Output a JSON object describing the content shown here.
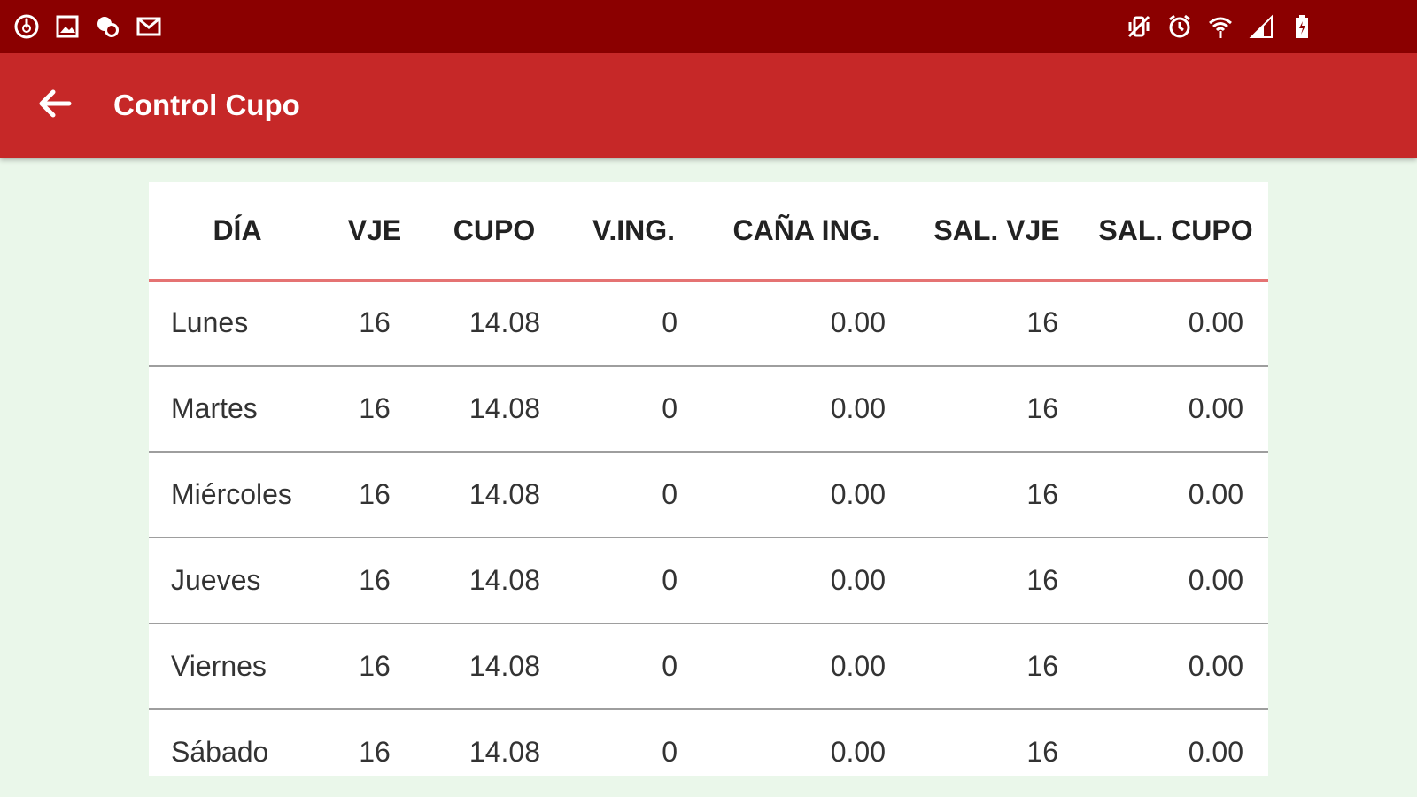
{
  "status_bar": {
    "left_icons": [
      "power-sync-icon",
      "image-icon",
      "chat-bubbles-icon",
      "mail-icon"
    ],
    "right_icons": [
      "vibrate-icon",
      "alarm-icon",
      "wifi-icon",
      "signal-icon",
      "battery-charging-icon"
    ]
  },
  "app_bar": {
    "title": "Control Cupo",
    "back_icon": "arrow-back-icon"
  },
  "colors": {
    "status_bar": "#8b0000",
    "app_bar": "#c62828",
    "background": "#eaf7ea",
    "header_divider": "#e57373"
  },
  "table": {
    "headers": [
      "DÍA",
      "VJE",
      "CUPO",
      "V.ING.",
      "CAÑA ING.",
      "SAL. VJE",
      "SAL. CUPO"
    ],
    "rows": [
      [
        "Lunes",
        "16",
        "14.08",
        "0",
        "0.00",
        "16",
        "0.00"
      ],
      [
        "Martes",
        "16",
        "14.08",
        "0",
        "0.00",
        "16",
        "0.00"
      ],
      [
        "Miércoles",
        "16",
        "14.08",
        "0",
        "0.00",
        "16",
        "0.00"
      ],
      [
        "Jueves",
        "16",
        "14.08",
        "0",
        "0.00",
        "16",
        "0.00"
      ],
      [
        "Viernes",
        "16",
        "14.08",
        "0",
        "0.00",
        "16",
        "0.00"
      ],
      [
        "Sábado",
        "16",
        "14.08",
        "0",
        "0.00",
        "16",
        "0.00"
      ]
    ]
  }
}
